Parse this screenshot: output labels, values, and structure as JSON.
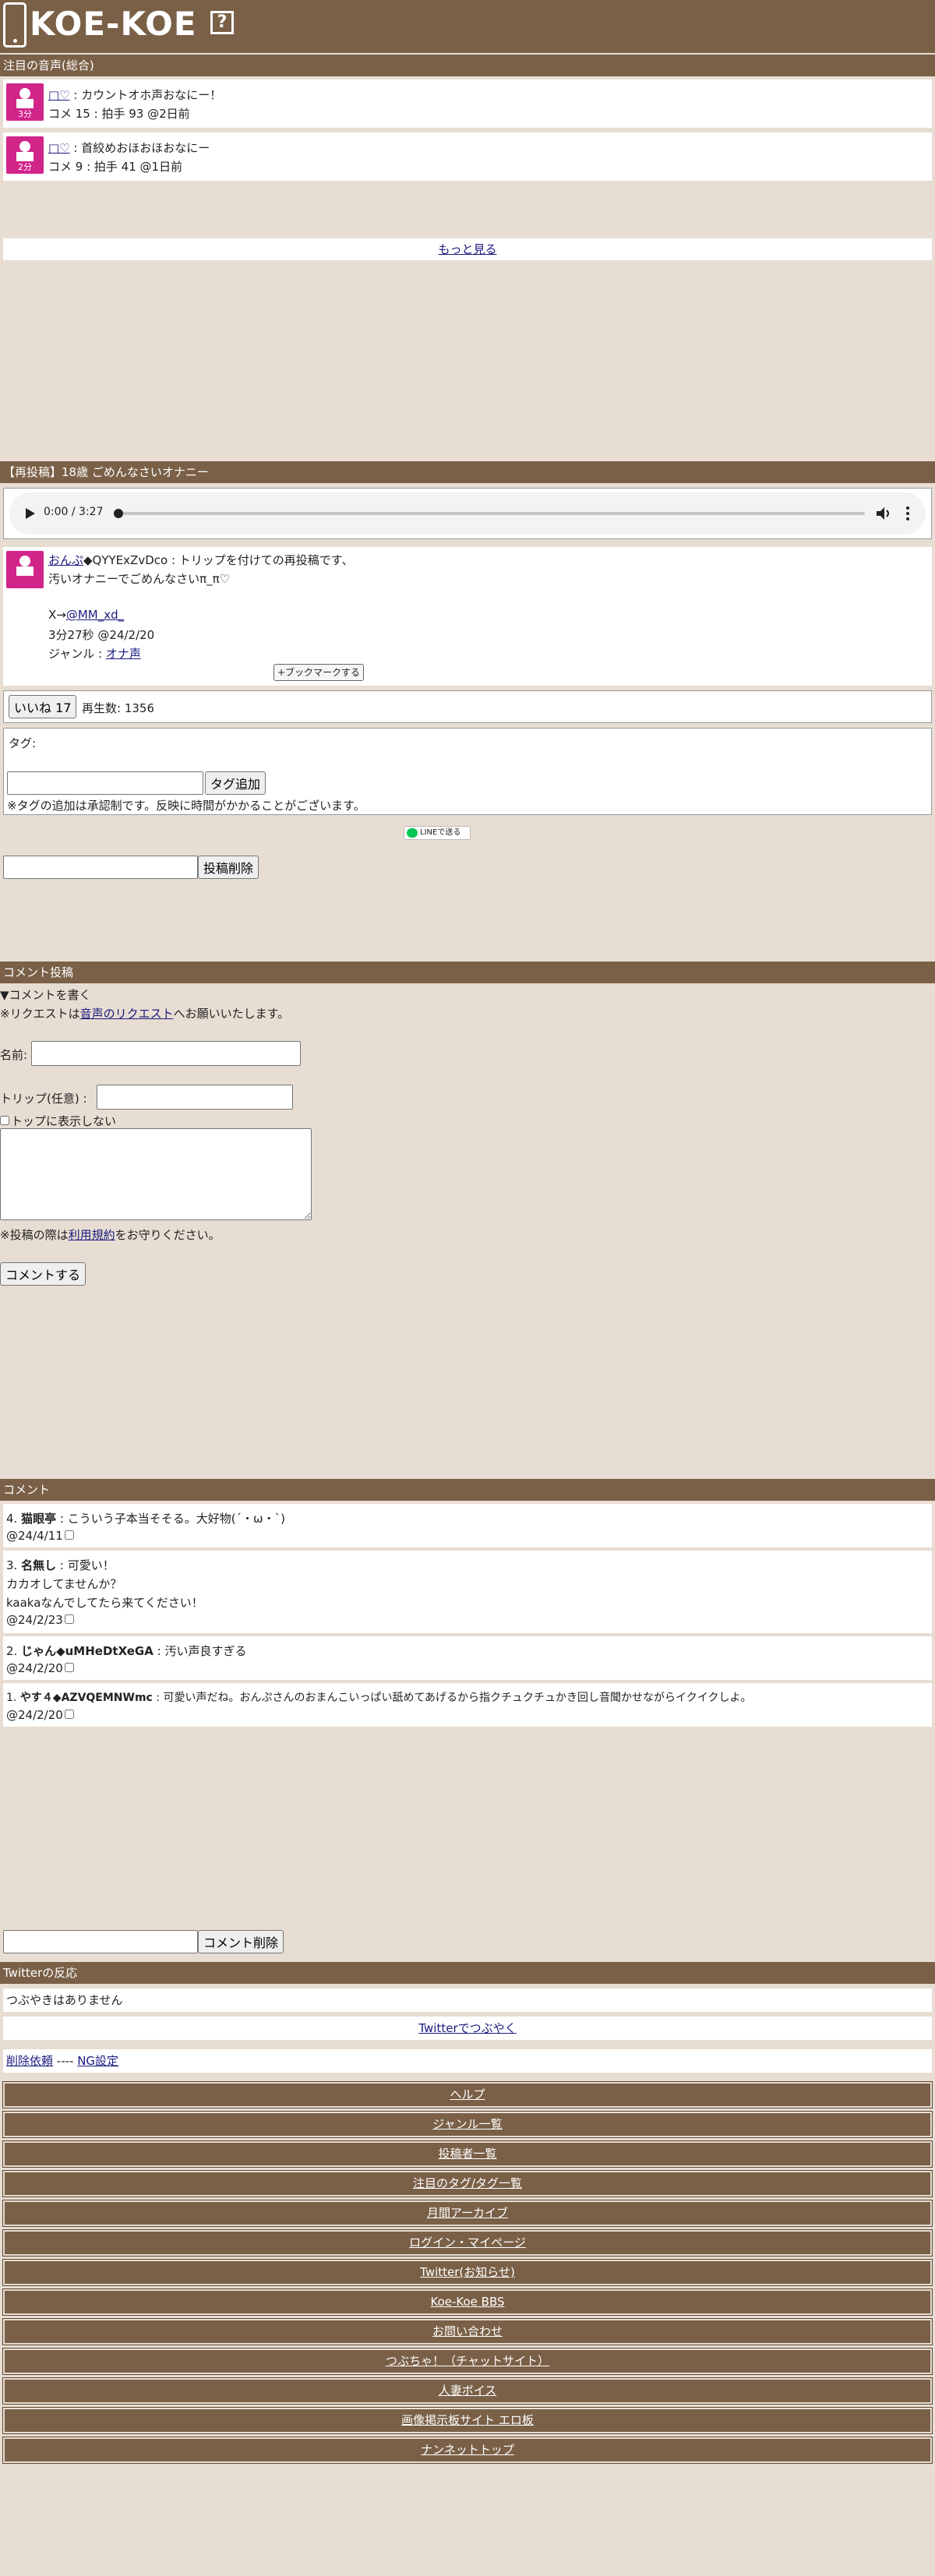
{
  "site": {
    "logo": "KOE-KOE",
    "help": "?"
  },
  "featured": {
    "heading": "注目の音声(総合)",
    "items": [
      {
        "dur": "3分",
        "user": "□♡",
        "title": "カウントオホ声おなにー！",
        "stats": "コメ 15 : 拍手 93 @2日前"
      },
      {
        "dur": "2分",
        "user": "□♡",
        "title": "首絞めおほおほおなにー",
        "stats": "コメ 9 : 拍手 41 @1日前"
      }
    ],
    "more": "もっと見る"
  },
  "post": {
    "heading": "【再投稿】18歳 ごめんなさいオナニー",
    "audio_time": "0:00 / 3:27",
    "author": "おんぷ",
    "trip": "◆QYYExZvDco",
    "desc1": "トリップを付けての再投稿です、",
    "desc2": "汚いオナニーでごめんなさいπ_π♡",
    "x_prefix": "X→",
    "x_handle": "@MM_xd_",
    "meta": "3分27秒 @24/2/20",
    "genre_label": "ジャンル : ",
    "genre": "オナ声",
    "bookmark": "+ブックマークする",
    "like": "いいね 17",
    "plays": "再生数: 1356",
    "tag_label": "タグ:",
    "tag_add": "タグ追加",
    "tag_note": "※タグの追加は承認制です。反映に時間がかかることがございます。",
    "line_share": "LINEで送る",
    "delete": "投稿削除"
  },
  "comment_form": {
    "heading": "コメント投稿",
    "toggle": "▼コメントを書く",
    "note_pre": "※リクエストは",
    "note_link": "音声のリクエスト",
    "note_post": "へお願いいたします。",
    "name_label": "名前:",
    "trip_label": "トリップ(任意) :",
    "hide_top": "トップに表示しない",
    "terms_pre": "※投稿の際は",
    "terms_link": "利用規約",
    "terms_post": "をお守りください。",
    "submit": "コメントする"
  },
  "comments": {
    "heading": "コメント",
    "items": [
      {
        "num": "4.",
        "name": "猫眼亭",
        "lines": [
          "こういう子本当そそる。大好物(´・ω・`)"
        ],
        "date": "@24/4/11"
      },
      {
        "num": "3.",
        "name": "名無し",
        "lines": [
          "可愛い！",
          "カカオしてませんか？",
          "kaakaなんでしてたら来てください！"
        ],
        "date": "@24/2/23"
      },
      {
        "num": "2.",
        "name": "じゃん◆uMHeDtXeGA",
        "lines": [
          "汚い声良すぎる"
        ],
        "date": "@24/2/20"
      },
      {
        "num": "1.",
        "name": "やす４◆AZVQEMNWmc",
        "lines": [
          "可愛い声だね。おんぷさんのおまんこいっぱい舐めてあげるから指クチュクチュかき回し音聞かせながらイクイクしよ。"
        ],
        "date": "@24/2/20"
      }
    ],
    "delete": "コメント削除"
  },
  "twitter": {
    "heading": "Twitterの反応",
    "empty": "つぶやきはありません",
    "tweet": "Twitterでつぶやく",
    "del_req": "削除依頼",
    "sep": " ---- ",
    "ng": "NG設定"
  },
  "footer": [
    "ヘルプ",
    "ジャンル一覧",
    "投稿者一覧",
    "注目のタグ/タグ一覧",
    "月間アーカイブ",
    "ログイン・マイページ",
    "Twitter(お知らせ)",
    "Koe-Koe BBS",
    "お問い合わせ",
    "つぶちゃ！（チャットサイト）",
    "人妻ボイス",
    "画像掲示板サイト エロ板",
    "ナンネットトップ"
  ],
  "colors": {
    "header": "#7a6047",
    "bg": "#e8ddd2",
    "thumb": "#d1258a",
    "line": "#06c755"
  }
}
